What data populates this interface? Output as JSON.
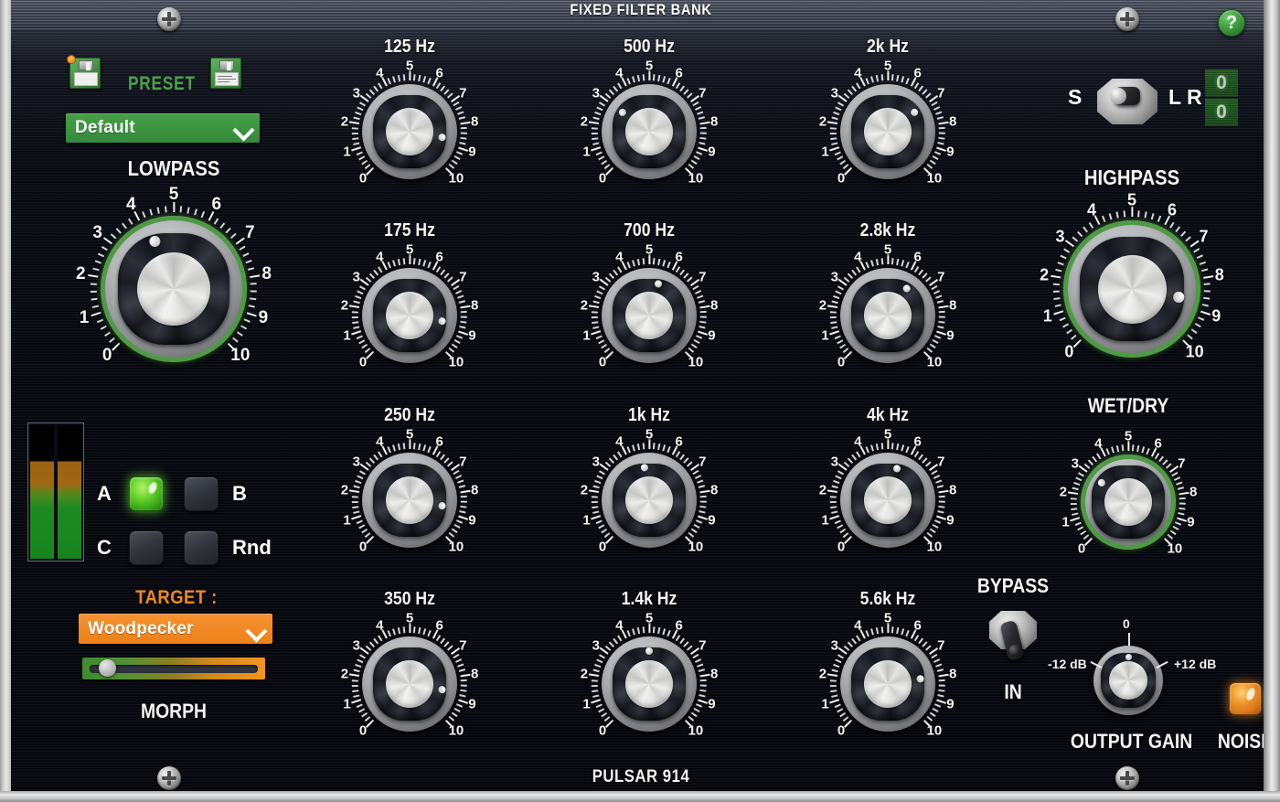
{
  "plugin": {
    "header_title": "FIXED FILTER BANK",
    "footer_title": "PULSAR 914",
    "help_label": "?"
  },
  "preset": {
    "label": "PRESET",
    "load_icon": "floppy-load-icon",
    "save_icon": "floppy-save-icon",
    "selected": "Default"
  },
  "io": {
    "stereo_label": "S",
    "lr_label": "L R",
    "meter_left": "0",
    "meter_right": "0"
  },
  "morph_section": {
    "slot_a": "A",
    "slot_b": "B",
    "slot_c": "C",
    "slot_rnd": "Rnd",
    "active_slot": "A",
    "target_label": "TARGET :",
    "target_value": "Woodpecker",
    "morph_label": "MORPH",
    "morph_position_pct": 9,
    "meter_left_pct": 73,
    "meter_right_pct": 73
  },
  "main_knobs": [
    {
      "name": "lowpass",
      "label": "LOWPASS",
      "value": 4.2,
      "ring": true
    },
    {
      "name": "highpass",
      "label": "HIGHPASS",
      "value": 8.7,
      "ring": true
    },
    {
      "name": "wetdry",
      "label": "WET/DRY",
      "value": 3.0,
      "ring": true
    }
  ],
  "filter_bank": {
    "rows": [
      [
        {
          "label": "125 Hz",
          "value": 8.7
        },
        {
          "label": "500 Hz",
          "value": 3.0
        },
        {
          "label": "2k Hz",
          "value": 7.0
        }
      ],
      [
        {
          "label": "175 Hz",
          "value": 8.7
        },
        {
          "label": "700 Hz",
          "value": 5.6
        },
        {
          "label": "2.8k Hz",
          "value": 6.3
        }
      ],
      [
        {
          "label": "250 Hz",
          "value": 8.7
        },
        {
          "label": "1k Hz",
          "value": 4.7
        },
        {
          "label": "4k Hz",
          "value": 5.6
        }
      ],
      [
        {
          "label": "350 Hz",
          "value": 8.7
        },
        {
          "label": "1.4k Hz",
          "value": 5.0
        },
        {
          "label": "5.6k Hz",
          "value": 8.0
        }
      ]
    ]
  },
  "scale": {
    "numerals": [
      "0",
      "1",
      "2",
      "3",
      "4",
      "5",
      "6",
      "7",
      "8",
      "9",
      "10"
    ]
  },
  "bypass": {
    "label": "BYPASS",
    "state_label": "IN"
  },
  "output_gain": {
    "label": "OUTPUT GAIN",
    "min_label": "-12 dB",
    "center_label": "0",
    "max_label": "+12 dB",
    "value": 5.0
  },
  "noise": {
    "label": "NOISE",
    "active": true
  },
  "colors": {
    "accent_green": "#4f9a44",
    "accent_orange": "#ef8a1c",
    "panel_dark": "#080a12",
    "preset_green": "#46a046"
  }
}
